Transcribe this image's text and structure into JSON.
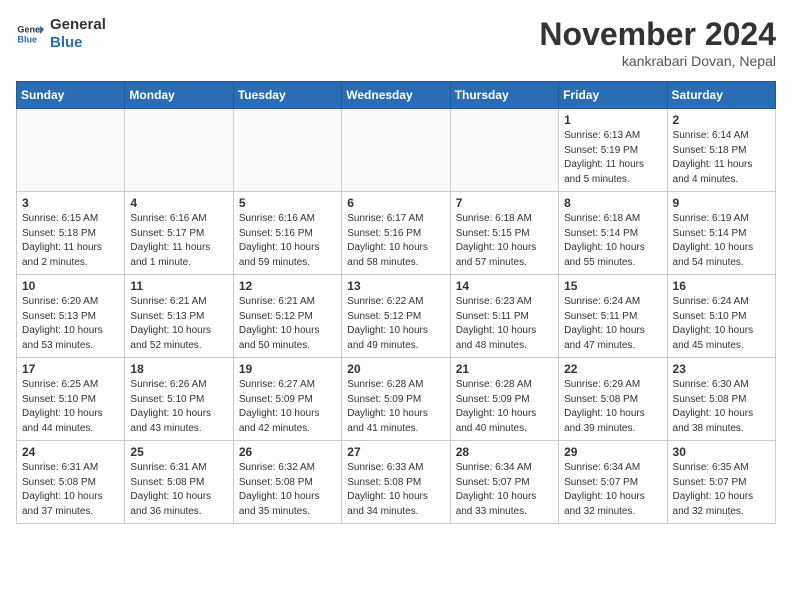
{
  "logo": {
    "general": "General",
    "blue": "Blue"
  },
  "header": {
    "month": "November 2024",
    "location": "kankrabari Dovan, Nepal"
  },
  "weekdays": [
    "Sunday",
    "Monday",
    "Tuesday",
    "Wednesday",
    "Thursday",
    "Friday",
    "Saturday"
  ],
  "weeks": [
    [
      {
        "day": "",
        "info": ""
      },
      {
        "day": "",
        "info": ""
      },
      {
        "day": "",
        "info": ""
      },
      {
        "day": "",
        "info": ""
      },
      {
        "day": "",
        "info": ""
      },
      {
        "day": "1",
        "info": "Sunrise: 6:13 AM\nSunset: 5:19 PM\nDaylight: 11 hours and 5 minutes."
      },
      {
        "day": "2",
        "info": "Sunrise: 6:14 AM\nSunset: 5:18 PM\nDaylight: 11 hours and 4 minutes."
      }
    ],
    [
      {
        "day": "3",
        "info": "Sunrise: 6:15 AM\nSunset: 5:18 PM\nDaylight: 11 hours and 2 minutes."
      },
      {
        "day": "4",
        "info": "Sunrise: 6:16 AM\nSunset: 5:17 PM\nDaylight: 11 hours and 1 minute."
      },
      {
        "day": "5",
        "info": "Sunrise: 6:16 AM\nSunset: 5:16 PM\nDaylight: 10 hours and 59 minutes."
      },
      {
        "day": "6",
        "info": "Sunrise: 6:17 AM\nSunset: 5:16 PM\nDaylight: 10 hours and 58 minutes."
      },
      {
        "day": "7",
        "info": "Sunrise: 6:18 AM\nSunset: 5:15 PM\nDaylight: 10 hours and 57 minutes."
      },
      {
        "day": "8",
        "info": "Sunrise: 6:18 AM\nSunset: 5:14 PM\nDaylight: 10 hours and 55 minutes."
      },
      {
        "day": "9",
        "info": "Sunrise: 6:19 AM\nSunset: 5:14 PM\nDaylight: 10 hours and 54 minutes."
      }
    ],
    [
      {
        "day": "10",
        "info": "Sunrise: 6:20 AM\nSunset: 5:13 PM\nDaylight: 10 hours and 53 minutes."
      },
      {
        "day": "11",
        "info": "Sunrise: 6:21 AM\nSunset: 5:13 PM\nDaylight: 10 hours and 52 minutes."
      },
      {
        "day": "12",
        "info": "Sunrise: 6:21 AM\nSunset: 5:12 PM\nDaylight: 10 hours and 50 minutes."
      },
      {
        "day": "13",
        "info": "Sunrise: 6:22 AM\nSunset: 5:12 PM\nDaylight: 10 hours and 49 minutes."
      },
      {
        "day": "14",
        "info": "Sunrise: 6:23 AM\nSunset: 5:11 PM\nDaylight: 10 hours and 48 minutes."
      },
      {
        "day": "15",
        "info": "Sunrise: 6:24 AM\nSunset: 5:11 PM\nDaylight: 10 hours and 47 minutes."
      },
      {
        "day": "16",
        "info": "Sunrise: 6:24 AM\nSunset: 5:10 PM\nDaylight: 10 hours and 45 minutes."
      }
    ],
    [
      {
        "day": "17",
        "info": "Sunrise: 6:25 AM\nSunset: 5:10 PM\nDaylight: 10 hours and 44 minutes."
      },
      {
        "day": "18",
        "info": "Sunrise: 6:26 AM\nSunset: 5:10 PM\nDaylight: 10 hours and 43 minutes."
      },
      {
        "day": "19",
        "info": "Sunrise: 6:27 AM\nSunset: 5:09 PM\nDaylight: 10 hours and 42 minutes."
      },
      {
        "day": "20",
        "info": "Sunrise: 6:28 AM\nSunset: 5:09 PM\nDaylight: 10 hours and 41 minutes."
      },
      {
        "day": "21",
        "info": "Sunrise: 6:28 AM\nSunset: 5:09 PM\nDaylight: 10 hours and 40 minutes."
      },
      {
        "day": "22",
        "info": "Sunrise: 6:29 AM\nSunset: 5:08 PM\nDaylight: 10 hours and 39 minutes."
      },
      {
        "day": "23",
        "info": "Sunrise: 6:30 AM\nSunset: 5:08 PM\nDaylight: 10 hours and 38 minutes."
      }
    ],
    [
      {
        "day": "24",
        "info": "Sunrise: 6:31 AM\nSunset: 5:08 PM\nDaylight: 10 hours and 37 minutes."
      },
      {
        "day": "25",
        "info": "Sunrise: 6:31 AM\nSunset: 5:08 PM\nDaylight: 10 hours and 36 minutes."
      },
      {
        "day": "26",
        "info": "Sunrise: 6:32 AM\nSunset: 5:08 PM\nDaylight: 10 hours and 35 minutes."
      },
      {
        "day": "27",
        "info": "Sunrise: 6:33 AM\nSunset: 5:08 PM\nDaylight: 10 hours and 34 minutes."
      },
      {
        "day": "28",
        "info": "Sunrise: 6:34 AM\nSunset: 5:07 PM\nDaylight: 10 hours and 33 minutes."
      },
      {
        "day": "29",
        "info": "Sunrise: 6:34 AM\nSunset: 5:07 PM\nDaylight: 10 hours and 32 minutes."
      },
      {
        "day": "30",
        "info": "Sunrise: 6:35 AM\nSunset: 5:07 PM\nDaylight: 10 hours and 32 minutes."
      }
    ]
  ]
}
